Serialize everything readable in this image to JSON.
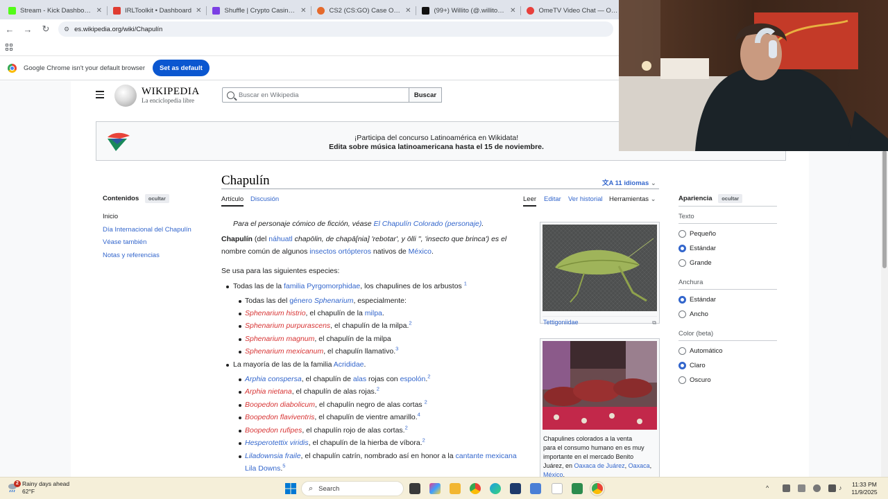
{
  "browser": {
    "tabs": [
      {
        "title": "Stream - Kick Dashboard",
        "favicon_color": "#53fc18"
      },
      {
        "title": "IRLToolkit • Dashboard",
        "favicon_color": "#e03c31"
      },
      {
        "title": "Shuffle | Crypto Casino & Bo...",
        "favicon_color": "#7b3fe4"
      },
      {
        "title": "CS2 (CS:GO) Case Opening W...",
        "favicon_color": "#e56a2c"
      },
      {
        "title": "(99+) Willito (@.willito) | TikTo...",
        "favicon_color": "#111111"
      },
      {
        "title": "OmeTV Video Chat — Omegl...",
        "favicon_color": "#e8403c"
      }
    ],
    "close_glyph": "✕",
    "url": "es.wikipedia.org/wiki/Chapulín",
    "infobar_text": "Google Chrome isn't your default browser",
    "infobar_button": "Set as default"
  },
  "wiki": {
    "wordmark": "WIKIPEDIA",
    "tagline": "La enciclopedia libre",
    "search_placeholder": "Buscar en Wikipedia",
    "search_button": "Buscar",
    "banner_line1": "¡Participa del concurso Latinoamérica en Wikidata!",
    "banner_line2": "Edita sobre música latinoamericana hasta el 15 de noviembre.",
    "title": "Chapulín",
    "languages": "11 idiomas",
    "tabs": {
      "article": "Artículo",
      "discussion": "Discusión",
      "read": "Leer",
      "edit": "Editar",
      "history": "Ver historial",
      "tools": "Herramientas"
    },
    "toc": {
      "title": "Contenidos",
      "hide": "ocultar",
      "items": [
        "Inicio",
        "Día Internacional del Chapulín",
        "Véase también",
        "Notas y referencias"
      ]
    },
    "hatnote": {
      "prefix": "Para el personaje cómico de ficción, véase ",
      "link": "El Chapulín Colorado (personaje)",
      "suffix": "."
    },
    "lead": {
      "bold": "Chapulín",
      "t1": " (del ",
      "l1": "náhuatl",
      "t2": " chapōlin, de chapā[nia] 'rebotar', y ōlli '', 'insecto que brinca') es el",
      "t3": "nombre común de algunos ",
      "l2": "insectos ortópteros",
      "t4": " nativos de ",
      "l3": "México",
      "t5": "."
    },
    "species_intro": "Se usa para las siguientes especies:",
    "list": {
      "i1_pre": "Todas las de la ",
      "i1_link": "familia Pyrgomorphidae",
      "i1_post": ", los chapulines de los arbustos",
      "i1_sup": "1",
      "s1_pre": "Todas las del ",
      "s1_link": "género",
      "s1_it": "Sphenarium",
      "s1_post": ", especialmente:",
      "s2_red": "Sphenarium histrio",
      "s2_post": ", el chapulín de la ",
      "s2_link": "milpa",
      "s2_end": ".",
      "s3_red": "Sphenarium purpurascens",
      "s3_post": ", el chapulín de la milpa.",
      "s3_sup": "2",
      "s4_red": "Sphenarium magnum",
      "s4_post": ", el chapulín de la milpa",
      "s5_red": "Sphenarium mexicanum",
      "s5_post": ", el chapulín llamativo.",
      "s5_sup": "3",
      "i2_pre": "La mayoría de las de la familia ",
      "i2_link": "Acrididae",
      "i2_end": ".",
      "a1_link": "Arphia conspersa",
      "a1_post": ", el chapulín de ",
      "a1_l2": "alas",
      "a1_mid": " rojas con ",
      "a1_l3": "espolón",
      "a1_end": ".",
      "a1_sup": "2",
      "a2_red": "Arphia nietana",
      "a2_post": ", el chapulín de alas rojas.",
      "a2_sup": "2",
      "a3_red": "Boopedon diabolicum",
      "a3_post": ", el chapulín negro de alas cortas",
      "a3_sup": "2",
      "a4_red": "Boopedon flaviventris",
      "a4_post": ", el chapulín de vientre amarillo.",
      "a4_sup": "4",
      "a5_red": "Boopedon rufipes",
      "a5_post": ", el chapulín rojo de alas cortas.",
      "a5_sup": "2",
      "a6_link": "Hesperotettix viridis",
      "a6_post": ", el chapulín de la hierba de víbora.",
      "a6_sup": "2",
      "a7_link": "Liladownsia fraile",
      "a7_post": ", el chapulín catrín, nombrado así en honor a la ",
      "a7_l2": "cantante mexicana",
      "a7_l3": "Lila Downs",
      "a7_end": ".",
      "a7_sup": "5"
    },
    "img1_caption": "Tettigoniidae",
    "img2_caption": {
      "t1": "Chapulines colorados a la venta",
      "t2": "para el consumo humano en es muy",
      "t3": "importante en el mercado Benito",
      "t4": "Juárez, en ",
      "l1": "Oaxaca de Juárez",
      "t5": ", ",
      "l2": "Oaxaca",
      "t6": ",",
      "l3": "México",
      "t7": "."
    },
    "appearance": {
      "title": "Apariencia",
      "hide": "ocultar",
      "text_label": "Texto",
      "text_options": [
        "Pequeño",
        "Estándar",
        "Grande"
      ],
      "width_label": "Anchura",
      "width_options": [
        "Estándar",
        "Ancho"
      ],
      "color_label": "Color (beta)",
      "color_options": [
        "Automático",
        "Claro",
        "Oscuro"
      ]
    }
  },
  "taskbar": {
    "weather_line1": "Rainy days ahead",
    "weather_line2": "62°F",
    "notification_count": "2",
    "search_placeholder": "Search",
    "time": "11:33 PM",
    "date": "11/9/2025"
  }
}
